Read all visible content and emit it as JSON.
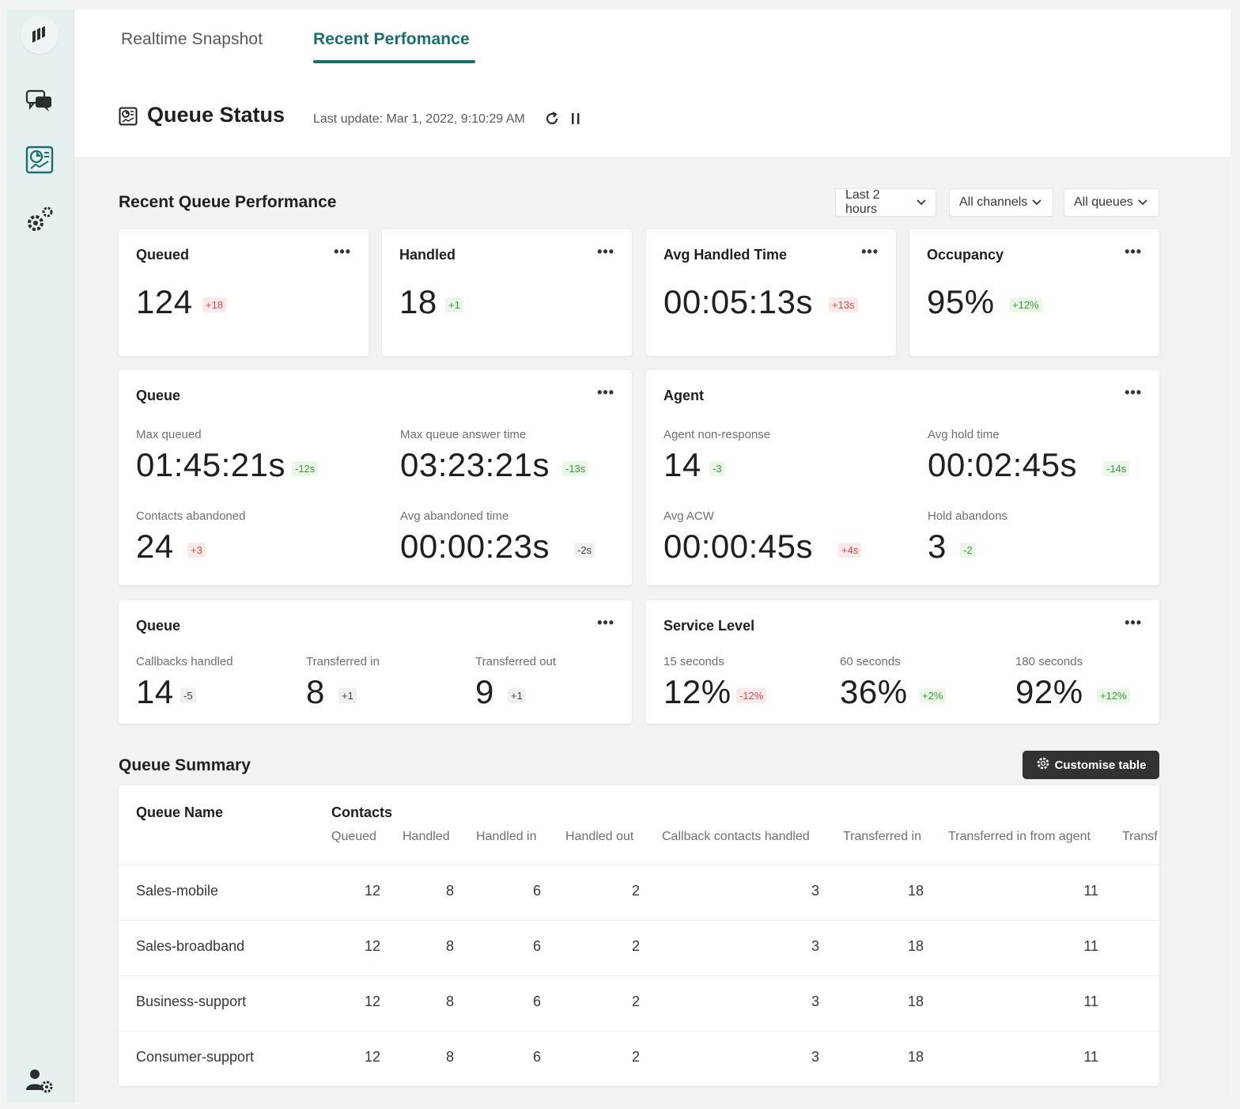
{
  "tabs": [
    {
      "label": "Realtime Snapshot"
    },
    {
      "label": "Recent Perfomance"
    }
  ],
  "header": {
    "title": "Queue Status",
    "last_update": "Last update: Mar 1, 2022, 9:10:29 AM"
  },
  "recent": {
    "title": "Recent Queue Performance",
    "filters": [
      "Last 2 hours",
      "All channels",
      "All queues"
    ]
  },
  "kpis": [
    {
      "title": "Queued",
      "value": "124",
      "delta": "+18"
    },
    {
      "title": "Handled",
      "value": "18",
      "delta": "+1"
    },
    {
      "title": "Avg Handled Time",
      "value": "00:05:13s",
      "delta": "+13s"
    },
    {
      "title": "Occupancy",
      "value": "95%",
      "delta": "+12%"
    }
  ],
  "queue_card": {
    "title": "Queue",
    "metrics": [
      {
        "label": "Max queued",
        "value": "01:45:21s",
        "delta": "-12s"
      },
      {
        "label": "Max queue answer time",
        "value": "03:23:21s",
        "delta": "-13s"
      },
      {
        "label": "Contacts abandoned",
        "value": "24",
        "delta": "+3"
      },
      {
        "label": "Avg abandoned time",
        "value": "00:00:23s",
        "delta": "-2s"
      }
    ]
  },
  "agent_card": {
    "title": "Agent",
    "metrics": [
      {
        "label": "Agent non-response",
        "value": "14",
        "delta": "-3"
      },
      {
        "label": "Avg hold time",
        "value": "00:02:45s",
        "delta": "-14s"
      },
      {
        "label": "Avg ACW",
        "value": "00:00:45s",
        "delta": "+4s"
      },
      {
        "label": "Hold abandons",
        "value": "3",
        "delta": "-2"
      }
    ]
  },
  "queue_card2": {
    "title": "Queue",
    "metrics": [
      {
        "label": "Callbacks handled",
        "value": "14",
        "delta": "-5"
      },
      {
        "label": "Transferred in",
        "value": "8",
        "delta": "+1"
      },
      {
        "label": "Transferred out",
        "value": "9",
        "delta": "+1"
      }
    ]
  },
  "service_card": {
    "title": "Service Level",
    "metrics": [
      {
        "label": "15 seconds",
        "value": "12%",
        "delta": "-12%"
      },
      {
        "label": "60 seconds",
        "value": "36%",
        "delta": "+2%"
      },
      {
        "label": "180 seconds",
        "value": "92%",
        "delta": "+12%"
      }
    ]
  },
  "summary": {
    "title": "Queue Summary",
    "customise_label": "Customise table",
    "col_queue_name": "Queue Name",
    "col_group": "Contacts",
    "sub_columns": [
      "Queued",
      "Handled",
      "Handled in",
      "Handled out",
      "Callback contacts handled",
      "Transferred in",
      "Transferred in from agent",
      "Transf"
    ],
    "rows": [
      {
        "name": "Sales-mobile",
        "values": [
          "12",
          "8",
          "6",
          "2",
          "3",
          "18",
          "11"
        ]
      },
      {
        "name": "Sales-broadband",
        "values": [
          "12",
          "8",
          "6",
          "2",
          "3",
          "18",
          "11"
        ]
      },
      {
        "name": "Business-support",
        "values": [
          "12",
          "8",
          "6",
          "2",
          "3",
          "18",
          "11"
        ]
      },
      {
        "name": "Consumer-support",
        "values": [
          "12",
          "8",
          "6",
          "2",
          "3",
          "18",
          "11"
        ]
      }
    ]
  },
  "icons": {
    "sidebar": [
      "logo-icon",
      "chat-icon",
      "dashboard-icon",
      "settings-icon",
      "user-settings-icon"
    ],
    "header": [
      "queue-status-icon",
      "refresh-icon",
      "pause-icon"
    ]
  },
  "colors": {
    "accent": "#1b6f6a",
    "negative": "#d04d56",
    "positive": "#3c9a3c",
    "button_dark": "#2f3335"
  }
}
